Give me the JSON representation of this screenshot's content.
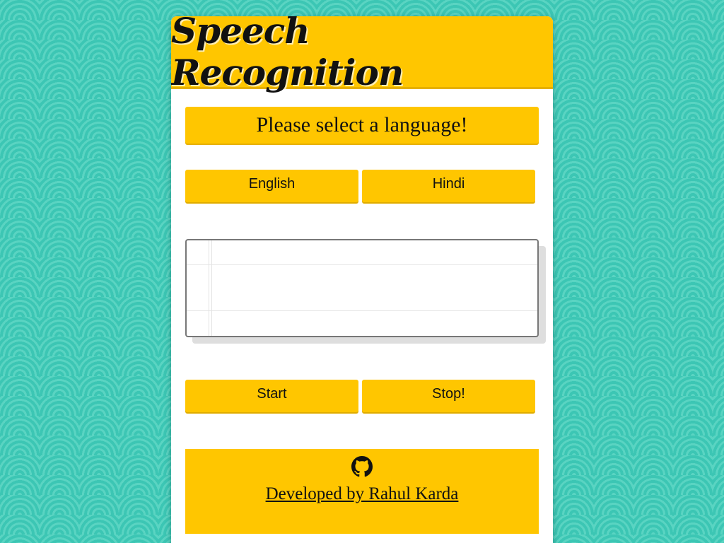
{
  "header": {
    "title": "Speech Recognition"
  },
  "prompt": {
    "text": "Please select a language!"
  },
  "language_buttons": {
    "english_label": "English",
    "hindi_label": "Hindi"
  },
  "transcript": {
    "value": ""
  },
  "controls": {
    "start_label": "Start",
    "stop_label": "Stop!"
  },
  "footer": {
    "icon": "github-icon",
    "link_text": "Developed by Rahul Karda"
  },
  "colors": {
    "accent": "#ffc600",
    "background": "#3cc6b4",
    "card": "#ffffff"
  }
}
